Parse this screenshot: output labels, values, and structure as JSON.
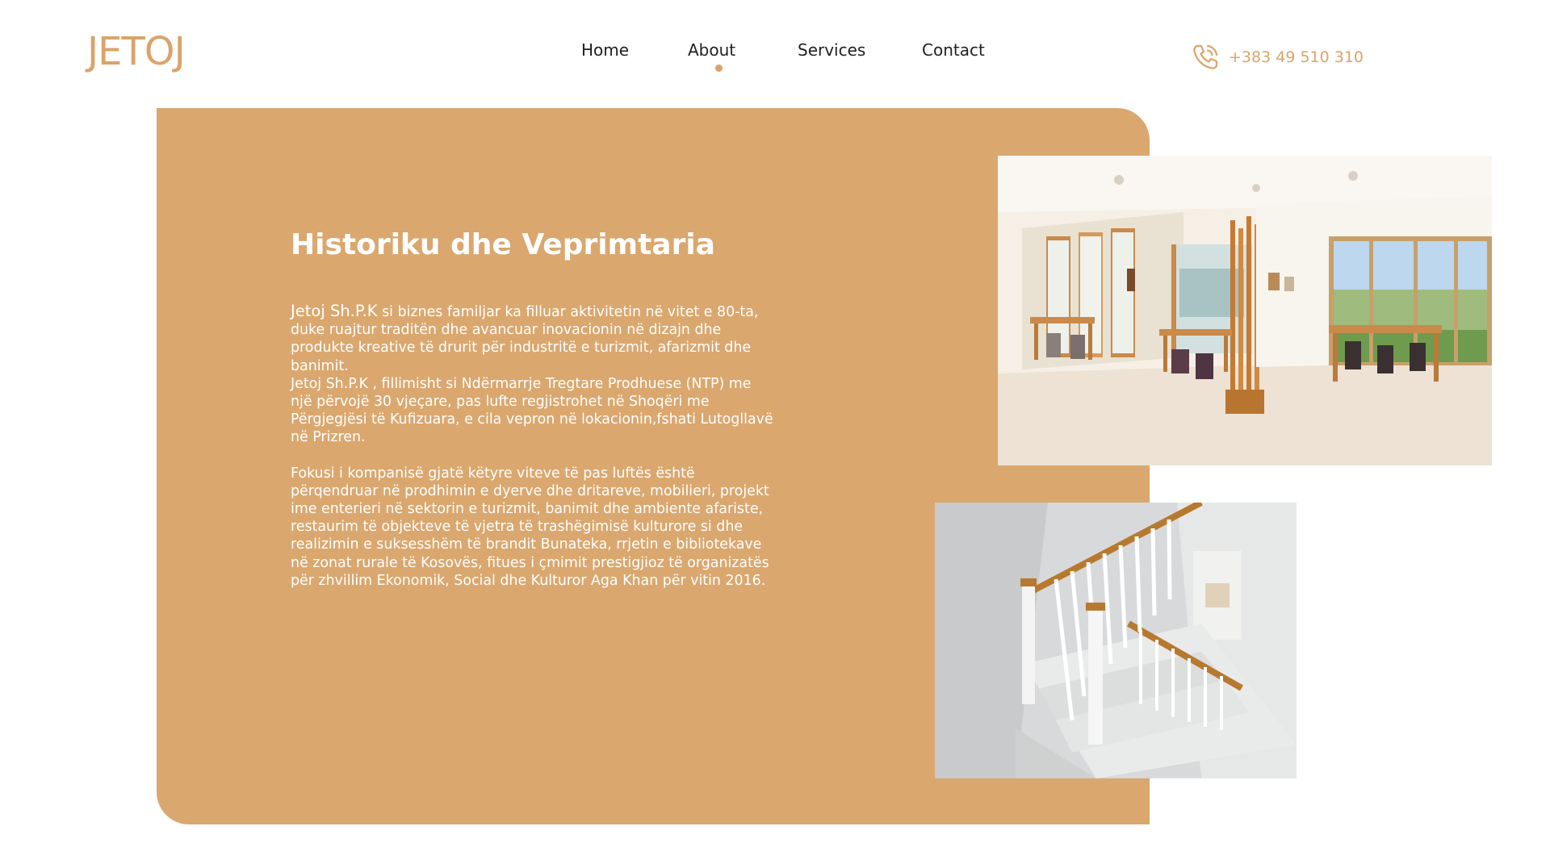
{
  "brand": {
    "logo_text": "JETOJ",
    "accent_color": "#daa76e"
  },
  "nav": {
    "items": [
      {
        "label": "Home",
        "active": false
      },
      {
        "label": "About",
        "active": true
      },
      {
        "label": "Services",
        "active": false
      },
      {
        "label": "Contact",
        "active": false
      }
    ]
  },
  "contact": {
    "phone_icon": "phone-call-icon",
    "phone": "+383 49 510 310"
  },
  "about": {
    "title": "Historiku dhe Veprimtaria",
    "paragraph1_lead": "Jetoj Sh.P.K",
    "paragraph1_rest": " si biznes familjar ka filluar aktivitetin në vitet e 80-ta, duke ruajtur traditën dhe avancuar inovacionin në dizajn dhe produkte kreative të drurit për industritë e turizmit, afarizmit dhe banimit.",
    "paragraph2": "Jetoj Sh.P.K , fillimisht si Ndërmarrje Tregtare Prodhuese (NTP) me një përvojë 30 vjeçare, pas lufte regjistrohet në Shoqëri me Përgjegjësi të Kufizuara, e cila vepron në lokacionin,fshati Lutogllavë në Prizren.",
    "paragraph3": "Fokusi i kompanisë gjatë këtyre viteve të pas luftës është përqendruar në prodhimin e dyerve dhe dritareve, mobilieri, projekt ime enterieri në sektorin e turizmit, banimit dhe ambiente afariste, restaurim të objekteve të vjetra të trashëgimisë kulturore si dhe realizimin e suksesshëm të brandit Bunateka, rrjetin e bibliotekave në zonat rurale të Kosovës, fitues i çmimit prestigjioz të organizatës për zhvillim Ekonomik, Social dhe Kulturor Aga Khan për vitin 2016."
  }
}
